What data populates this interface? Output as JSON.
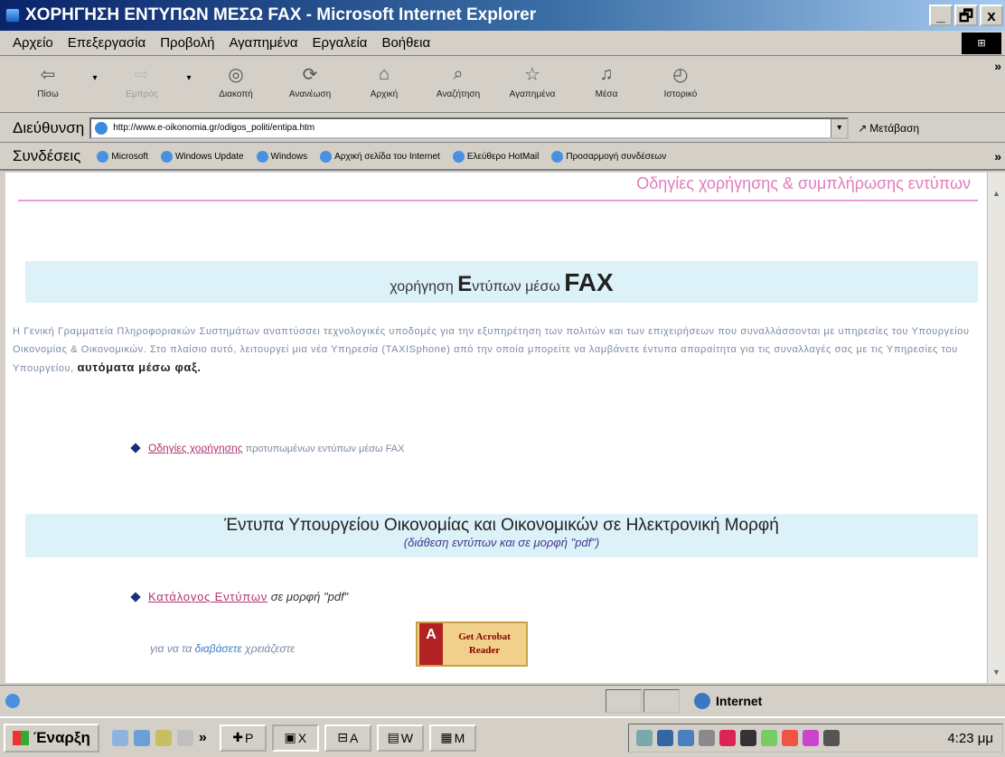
{
  "window": {
    "title": "ΧΟΡΗΓΗΣΗ ΕΝΤΥΠΩΝ ΜΕΣΩ FAX - Microsoft Internet Explorer",
    "buttons": [
      "_",
      "🗗",
      "x"
    ]
  },
  "menubar": {
    "items": [
      "Αρχείο",
      "Επεξεργασία",
      "Προβολή",
      "Αγαπημένα",
      "Εργαλεία",
      "Βοήθεια"
    ]
  },
  "toolbar": {
    "back": "Πίσω",
    "forward": "Εμπρός",
    "stop": "Διακοπή",
    "refresh": "Ανανέωση",
    "home": "Αρχική",
    "search": "Αναζήτηση",
    "favorites": "Αγαπημένα",
    "media": "Μέσα",
    "history": "Ιστορικό"
  },
  "address": {
    "label": "Διεύθυνση",
    "url": "http://www.e-oikonomia.gr/odigos_politi/entipa.htm",
    "go": "Μετάβαση"
  },
  "links": {
    "label": "Συνδέσεις",
    "items": [
      "Microsoft",
      "Windows Update",
      "Windows",
      "Αρχική σελίδα του Internet",
      "Ελεύθερο HotMail",
      "Προσαρμογή συνδέσεων"
    ]
  },
  "page": {
    "top_link": "Οδηγίες χορήγησης & συμπλήρωσης εντύπων",
    "banner1": {
      "w1": "χορήγηση ",
      "w2": "Ε",
      "w3": "ντύπων μέσω ",
      "w4": "FAX"
    },
    "paragraph": "Η Γενική Γραμματεία Πληροφοριακών Συστημάτων αναπτύσσει τεχνολογικές υποδομές για την εξυπηρέτηση των πολιτών και των επιχειρήσεων που συναλλάσσονται με υπηρεσίες του Υπουργείου Οικονομίας & Οικονομικών. Στο πλαίσιο αυτό, λειτουργεί μια νέα Υπηρεσία (TAXISphone) από την οποία μπορείτε να λαμβάνετε έντυπα απαραίτητα για τις συναλλαγές σας με τις Υπηρεσίες του Υπουργείου,",
    "paragraph_bold": "αυτόματα μέσω φαξ.",
    "bullet1_link": "Οδηγίες χορήγησης",
    "bullet1_text": "προτυπωμένων εντύπων μέσω FAX",
    "banner2_title": "Έντυπα Υπουργείου Οικονομίας και Οικονομικών σε Ηλεκτρονική Μορφή",
    "banner2_sub": "(διάθεση εντύπων και σε μορφή \"pdf\")",
    "bullet2_link": "Κατάλογος Εντύπων",
    "bullet2_text": "σε μορφή \"pdf\"",
    "read_prefix": "για να τα ",
    "read_link": "διαβάσετε",
    "read_suffix": " χρειάζεστε",
    "acrobat_l1": "Get Acrobat",
    "acrobat_l2": "Reader",
    "acrobat_logo": "A"
  },
  "status": {
    "zone": "Internet"
  },
  "taskbar": {
    "start": "Έναρξη",
    "tasks": [
      "P",
      "X",
      "A",
      "W",
      "M"
    ],
    "clock": "4:23 μμ"
  }
}
